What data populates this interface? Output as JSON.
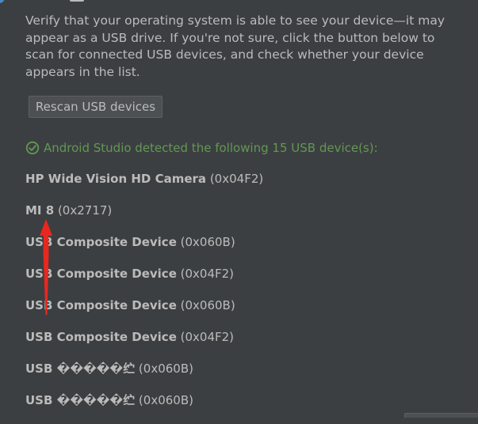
{
  "intro_text": "Verify that your operating system is able to see your device—it may appear as a USB drive. If you're not sure, click the button below to scan for connected USB devices, and check whether your device appears in the list.",
  "rescan_button": "Rescan USB devices",
  "status": {
    "text": "Android Studio detected the following 15 USB device(s):",
    "color": "#629755",
    "icon": "check-circle-icon"
  },
  "devices": [
    {
      "name": "HP Wide Vision HD Camera",
      "id": "(0x04F2)"
    },
    {
      "name": "MI 8",
      "id": "(0x2717)"
    },
    {
      "name": "USB Composite Device",
      "id": "(0x060B)"
    },
    {
      "name": "USB Composite Device",
      "id": "(0x04F2)"
    },
    {
      "name": "USB Composite Device",
      "id": "(0x060B)"
    },
    {
      "name": "USB Composite Device",
      "id": "(0x04F2)"
    },
    {
      "name": "USB �����纻",
      "id": "(0x060B)"
    },
    {
      "name": "USB �����纻",
      "id": "(0x060B)"
    }
  ],
  "annotation": {
    "arrow_color": "#e8281e"
  },
  "colors": {
    "background": "#3c3f41",
    "text": "#bbbbbb",
    "button_bg": "#4c5052",
    "button_border": "#5e6060"
  }
}
